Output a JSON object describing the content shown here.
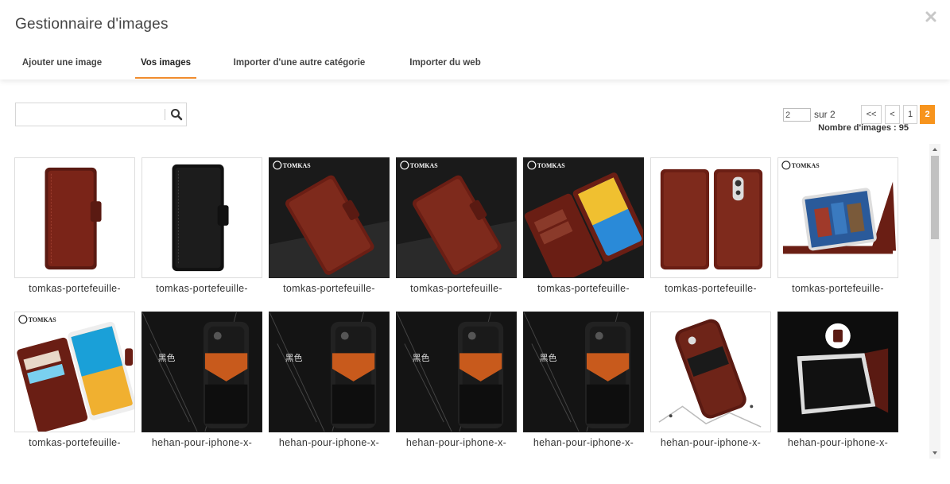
{
  "modal": {
    "title": "Gestionnaire d'images",
    "close_icon": "close-icon"
  },
  "tabs": [
    {
      "label": "Ajouter une image",
      "active": false
    },
    {
      "label": "Vos images",
      "active": true
    },
    {
      "label": "Importer d'une autre catégorie",
      "active": false
    },
    {
      "label": "Importer du web",
      "active": false
    }
  ],
  "search": {
    "value": "",
    "placeholder": "",
    "icon": "search-icon"
  },
  "pagination": {
    "page_input": "2",
    "of_label": "sur 2",
    "first_label": "<<",
    "prev_label": "<",
    "pages": [
      "1",
      "2"
    ],
    "current_page": "2",
    "count_label": "Nombre d'images : 95"
  },
  "accent_color": "#f7941d",
  "images": [
    {
      "caption": "tomkas-portefeuille-",
      "variant": "brown-wallet-white"
    },
    {
      "caption": "tomkas-portefeuille-",
      "variant": "black-wallet-white"
    },
    {
      "caption": "tomkas-portefeuille-",
      "variant": "brown-wallet-dark",
      "brand": "TOMKAS"
    },
    {
      "caption": "tomkas-portefeuille-",
      "variant": "brown-wallet-dark",
      "brand": "TOMKAS"
    },
    {
      "caption": "tomkas-portefeuille-",
      "variant": "open-wallet-dark",
      "brand": "TOMKAS"
    },
    {
      "caption": "tomkas-portefeuille-",
      "variant": "brown-double-white"
    },
    {
      "caption": "tomkas-portefeuille-",
      "variant": "stand-wallet-white",
      "brand": "TOMKAS"
    },
    {
      "caption": "tomkas-portefeuille-",
      "variant": "open-wallet-white",
      "brand": "TOMKAS"
    },
    {
      "caption": "hehan-pour-iphone-x-",
      "variant": "iphone-case-dark",
      "label": "黑色"
    },
    {
      "caption": "hehan-pour-iphone-x-",
      "variant": "iphone-case-dark",
      "label": "黑色"
    },
    {
      "caption": "hehan-pour-iphone-x-",
      "variant": "iphone-case-dark",
      "label": "黑色"
    },
    {
      "caption": "hehan-pour-iphone-x-",
      "variant": "iphone-case-dark",
      "label": "黑色"
    },
    {
      "caption": "hehan-pour-iphone-x-",
      "variant": "iphone-case-white"
    },
    {
      "caption": "hehan-pour-iphone-x-",
      "variant": "iphone-stand-dark"
    }
  ]
}
